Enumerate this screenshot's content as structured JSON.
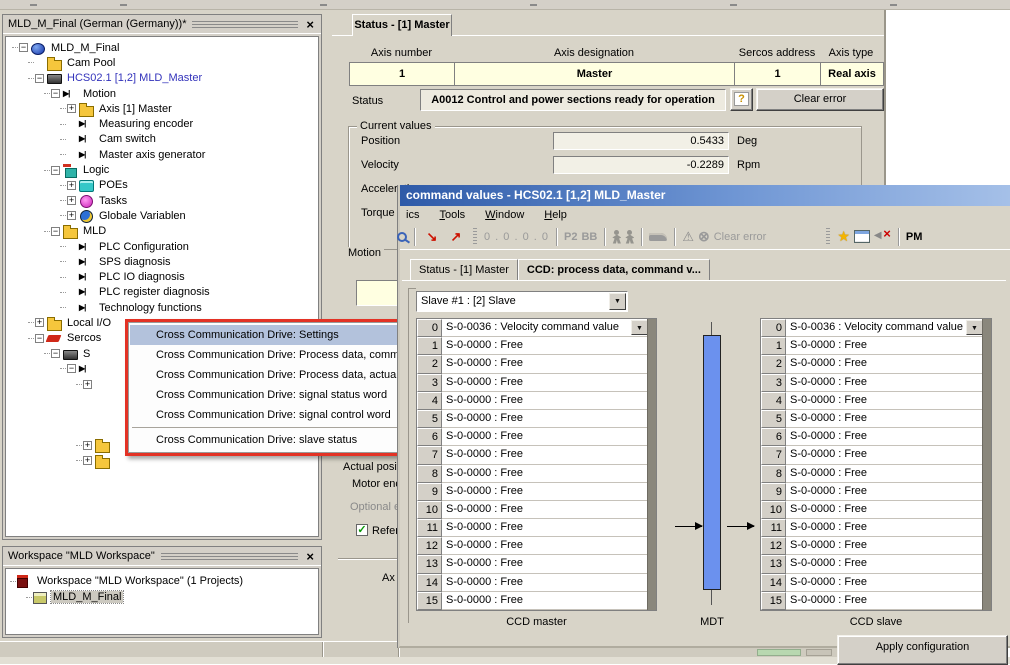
{
  "colors": {
    "annotation_red": "#E33225",
    "menu_highlight": "#B3C2DC",
    "cell_yellow": "#FFFFE1",
    "mdt_bar": "#6B91EE",
    "title_gradient_start": "#2E5AA8",
    "title_gradient_end": "#A5C0E8"
  },
  "tree_panel": {
    "title": "MLD_M_Final (German (Germany))*",
    "items": [
      {
        "label": "MLD_M_Final",
        "level": 0,
        "expander": "minus",
        "icon": "sphere"
      },
      {
        "label": "Cam Pool",
        "level": 1,
        "expander": "none",
        "icon": "folder"
      },
      {
        "label": "HCS02.1 [1,2] MLD_Master",
        "level": 1,
        "expander": "minus",
        "icon": "drive",
        "blue": true
      },
      {
        "label": "Motion",
        "level": 2,
        "expander": "minus",
        "icon": "motion"
      },
      {
        "label": "Axis [1] Master",
        "level": 3,
        "expander": "plus",
        "icon": "folder"
      },
      {
        "label": "Measuring encoder",
        "level": 3,
        "expander": "none",
        "icon": "motion"
      },
      {
        "label": "Cam switch",
        "level": 3,
        "expander": "none",
        "icon": "motion"
      },
      {
        "label": "Master axis generator",
        "level": 3,
        "expander": "none",
        "icon": "motion"
      },
      {
        "label": "Logic",
        "level": 2,
        "expander": "minus",
        "icon": "logic"
      },
      {
        "label": "POEs",
        "level": 3,
        "expander": "plus",
        "icon": "poe"
      },
      {
        "label": "Tasks",
        "level": 3,
        "expander": "plus",
        "icon": "task"
      },
      {
        "label": "Globale Variablen",
        "level": 3,
        "expander": "plus",
        "icon": "globe"
      },
      {
        "label": "MLD",
        "level": 2,
        "expander": "minus",
        "icon": "folder"
      },
      {
        "label": "PLC Configuration",
        "level": 3,
        "expander": "none",
        "icon": "motion"
      },
      {
        "label": "SPS diagnosis",
        "level": 3,
        "expander": "none",
        "icon": "motion"
      },
      {
        "label": "PLC IO diagnosis",
        "level": 3,
        "expander": "none",
        "icon": "motion"
      },
      {
        "label": "PLC register diagnosis",
        "level": 3,
        "expander": "none",
        "icon": "motion"
      },
      {
        "label": "Technology functions",
        "level": 3,
        "expander": "none",
        "icon": "motion"
      },
      {
        "label": "Local I/O",
        "level": 1,
        "expander": "plus",
        "icon": "folder"
      },
      {
        "label": "Sercos",
        "level": 1,
        "expander": "minus",
        "icon": "sercos"
      },
      {
        "label": "S",
        "level": 2,
        "expander": "minus",
        "icon": "drive"
      },
      {
        "label": "",
        "level": 3,
        "expander": "minus",
        "icon": "motion"
      },
      {
        "label": "",
        "level": 4,
        "expander": "plus",
        "icon": "none"
      },
      {
        "spacer": true
      },
      {
        "spacer": true
      },
      {
        "spacer": true
      },
      {
        "label": "",
        "level": 4,
        "expander": "plus",
        "icon": "folder"
      },
      {
        "label": "",
        "level": 4,
        "expander": "plus",
        "icon": "folder"
      }
    ]
  },
  "workspace_panel": {
    "title": "Workspace \"MLD Workspace\"",
    "items": [
      {
        "label": "Workspace \"MLD Workspace\" (1 Projects)",
        "icon": "workspace",
        "selected": false
      },
      {
        "label": "MLD_M_Final",
        "icon": "project",
        "selected": true
      }
    ]
  },
  "status_window": {
    "tab": "Status - [1] Master",
    "axis_table": {
      "headers": [
        "Axis number",
        "Axis designation",
        "Sercos address",
        "Axis type"
      ],
      "row": [
        "1",
        "Master",
        "1",
        "Real axis"
      ]
    },
    "status_label": "Status",
    "status_value": "A0012 Control and power sections ready for operation",
    "help_icon": "?",
    "clear_error_button": "Clear error",
    "current_values": {
      "title": "Current values",
      "rows": [
        {
          "label": "Position",
          "value": "0.5433",
          "unit": "Deg"
        },
        {
          "label": "Velocity",
          "value": "-0.2289",
          "unit": "Rpm"
        },
        {
          "label": "Acceleratio",
          "value": "",
          "unit": ""
        },
        {
          "label": "Torque / f",
          "value": "",
          "unit": ""
        }
      ]
    },
    "motion_group_label": "Motion",
    "fragments": {
      "actual_position": "Actual positi",
      "motor_encoder": "Motor enc",
      "optional_encoder": "Optional er",
      "reference": "Referen",
      "axis_button": "Ax"
    }
  },
  "context_menu": {
    "items": [
      {
        "label": "Cross Communication Drive: Settings",
        "selected": true
      },
      {
        "label": "Cross Communication Drive: Process data, comman"
      },
      {
        "label": "Cross Communication Drive: Process data, actual va"
      },
      {
        "label": "Cross Communication Drive: signal status word"
      },
      {
        "label": "Cross Communication Drive: signal control word"
      },
      {
        "label": "Cross Communication Drive: slave status",
        "separator_before": true
      }
    ]
  },
  "overlay_window": {
    "title": "command values - HCS02.1 [1,2] MLD_Master",
    "menu_items": [
      {
        "label": "ics",
        "underline": -1
      },
      {
        "label": "Tools",
        "underline": 0
      },
      {
        "label": "Window",
        "underline": 0
      },
      {
        "label": "Help",
        "underline": 0
      }
    ],
    "toolbar": {
      "address": "0 . 0 . 0 . 0",
      "phase": "P2",
      "bb": "BB",
      "clear_error": "Clear error",
      "pm": "PM"
    },
    "tabs": [
      {
        "label": "Status - [1] Master",
        "active": false
      },
      {
        "label": "CCD: process data, command v...",
        "active": true
      }
    ],
    "slave_selector": "Slave #1 : [2] Slave",
    "ccd_master": {
      "rows": [
        {
          "num": "0",
          "value": "S-0-0036 : Velocity command value",
          "dropdown": true
        },
        {
          "num": "1",
          "value": "S-0-0000 : Free"
        },
        {
          "num": "2",
          "value": "S-0-0000 : Free"
        },
        {
          "num": "3",
          "value": "S-0-0000 : Free"
        },
        {
          "num": "4",
          "value": "S-0-0000 : Free"
        },
        {
          "num": "5",
          "value": "S-0-0000 : Free"
        },
        {
          "num": "6",
          "value": "S-0-0000 : Free"
        },
        {
          "num": "7",
          "value": "S-0-0000 : Free"
        },
        {
          "num": "8",
          "value": "S-0-0000 : Free"
        },
        {
          "num": "9",
          "value": "S-0-0000 : Free"
        },
        {
          "num": "10",
          "value": "S-0-0000 : Free"
        },
        {
          "num": "11",
          "value": "S-0-0000 : Free"
        },
        {
          "num": "12",
          "value": "S-0-0000 : Free"
        },
        {
          "num": "13",
          "value": "S-0-0000 : Free"
        },
        {
          "num": "14",
          "value": "S-0-0000 : Free"
        },
        {
          "num": "15",
          "value": "S-0-0000 : Free"
        }
      ]
    },
    "ccd_slave": {
      "rows": [
        {
          "num": "0",
          "value": "S-0-0036 : Velocity command value",
          "dropdown": true
        },
        {
          "num": "1",
          "value": "S-0-0000 : Free"
        },
        {
          "num": "2",
          "value": "S-0-0000 : Free"
        },
        {
          "num": "3",
          "value": "S-0-0000 : Free"
        },
        {
          "num": "4",
          "value": "S-0-0000 : Free"
        },
        {
          "num": "5",
          "value": "S-0-0000 : Free"
        },
        {
          "num": "6",
          "value": "S-0-0000 : Free"
        },
        {
          "num": "7",
          "value": "S-0-0000 : Free"
        },
        {
          "num": "8",
          "value": "S-0-0000 : Free"
        },
        {
          "num": "9",
          "value": "S-0-0000 : Free"
        },
        {
          "num": "10",
          "value": "S-0-0000 : Free"
        },
        {
          "num": "11",
          "value": "S-0-0000 : Free"
        },
        {
          "num": "12",
          "value": "S-0-0000 : Free"
        },
        {
          "num": "13",
          "value": "S-0-0000 : Free"
        },
        {
          "num": "14",
          "value": "S-0-0000 : Free"
        },
        {
          "num": "15",
          "value": "S-0-0000 : Free"
        }
      ]
    },
    "footer_labels": {
      "master": "CCD master",
      "mdt": "MDT",
      "slave": "CCD slave"
    },
    "apply_button": "Apply configuration"
  }
}
